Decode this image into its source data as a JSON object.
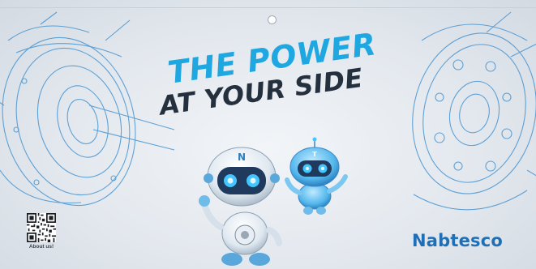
{
  "banner": {
    "headline_line1": "THE POWER",
    "headline_line2": "AT YOUR SIDE",
    "qr_caption": "About us!",
    "brand_name": "Nabtesco",
    "mascot_badges": [
      "N",
      "T"
    ]
  },
  "icons": {
    "qr": "qr-code-icon",
    "left_sketch": "gear-sketch-icon",
    "right_sketch": "gear-sketch-icon",
    "robots": "robot-mascot-icon"
  },
  "colors": {
    "headline_accent": "#1ea7e1",
    "headline_dark": "#24303e",
    "brand": "#1f6fb6",
    "sketch_lines": "#3d8fcf"
  }
}
